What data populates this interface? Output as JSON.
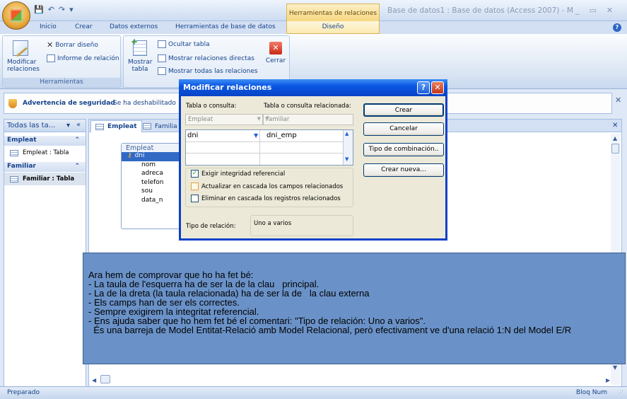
{
  "app": {
    "title": "Base de datos1 : Base de datos (Access 2007) - M",
    "context_tab": "Herramientas de relaciones"
  },
  "tabs": [
    "Inicio",
    "Crear",
    "Datos externos",
    "Herramientas de base de datos",
    "Diseño"
  ],
  "ribbon": {
    "modificar": "Modificar relaciones",
    "borrar": "Borrar diseño",
    "informe": "Informe de relación",
    "herramientas_label": "Herramientas",
    "mostrar_tabla": "Mostrar tabla",
    "ocultar": "Ocultar tabla",
    "directas": "Mostrar relaciones directas",
    "todas": "Mostrar todas las relaciones",
    "cerrar": "Cerrar"
  },
  "security": {
    "title": "Advertencia de seguridad",
    "text": "Se ha deshabilitado"
  },
  "nav": {
    "header": "Todas las ta...",
    "groups": [
      {
        "name": "Empleat",
        "item": "Empleat : Tabla"
      },
      {
        "name": "Familiar",
        "item": "Familiar : Tabla"
      }
    ]
  },
  "doc": {
    "tabs": [
      "Empleat",
      "Familia"
    ],
    "table": {
      "name": "Empleat",
      "fields": [
        "dni",
        "nom",
        "adreca",
        "telefon",
        "sou",
        "data_n"
      ]
    }
  },
  "dialog": {
    "title": "Modificar relaciones",
    "lbl_table": "Tabla o consulta:",
    "lbl_related": "Tabla o consulta relacionada:",
    "table": "Empleat",
    "related": "Familiar",
    "field_left": "dni",
    "field_right": "dni_emp",
    "chk1": "Exigir integridad referencial",
    "chk2": "Actualizar en cascada los campos relacionados",
    "chk3": "Eliminar en cascada los registros relacionados",
    "lbl_reltype": "Tipo de relación:",
    "reltype": "Uno a varios",
    "btn_crear": "Crear",
    "btn_cancelar": "Cancelar",
    "btn_tipo": "Tipo de combinación..",
    "btn_nueva": "Crear nueva..."
  },
  "note": {
    "lines": [
      "Ara hem de comprovar que ho ha fet bé:",
      "- La taula de l'esquerra ha de ser la de la clau   principal.",
      "- La de la dreta (la taula relacionada) ha de ser la de   la clau externa",
      "- Els camps han de ser els correctes.",
      "- Sempre exigirem la integritat referencial.",
      "- Ens ajuda saber que ho hem fet bé el comentari: \"Tipo de relación: Uno a varios\".",
      "  És una barreja de Model Entitat-Relació amb Model Relacional, però efectivament ve d'una relació 1:N del Model E/R"
    ]
  },
  "status": {
    "left": "Preparado",
    "right": "Bloq Num"
  }
}
